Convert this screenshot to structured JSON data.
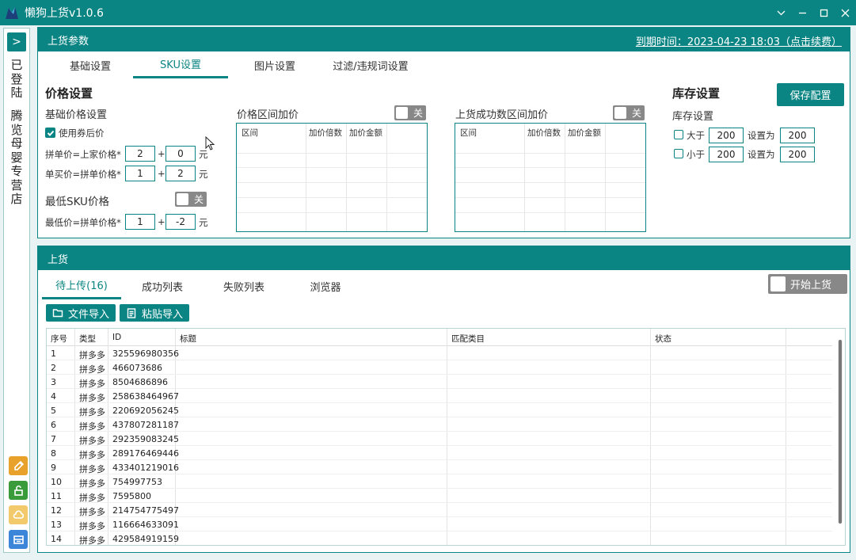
{
  "window": {
    "title": "懒狗上货v1.0.6",
    "accent": "#0b8583"
  },
  "sidebar": {
    "expand_label": ">",
    "login_status": "已登陆",
    "shop_name": "腾览母婴专营店",
    "buttons": [
      "edit-icon",
      "unlock-icon",
      "cloud-icon",
      "tray-icon"
    ]
  },
  "params": {
    "header": "上货参数",
    "expiry": "到期时间：2023-04-23 18:03（点击续费）",
    "tabs": [
      "基础设置",
      "SKU设置",
      "图片设置",
      "过滤/违规词设置"
    ],
    "active_tab": "SKU设置",
    "price": {
      "title": "价格设置",
      "basic_title": "基础价格设置",
      "use_coupon_label": "使用券后价",
      "group_price_label": "拼单价=上家价格*",
      "group_multiplier": "2",
      "group_add": "0",
      "single_price_label": "单买价=拼单价格*",
      "single_multiplier": "1",
      "single_add": "2",
      "plus": "+",
      "unit": "元",
      "min_sku_title": "最低SKU价格",
      "min_sku_toggle": "关",
      "min_price_label": "最低价=拼单价格*",
      "min_multiplier": "1",
      "min_add": "-2"
    },
    "range_markup": {
      "title": "价格区间加价",
      "toggle": "关",
      "columns": [
        "区间",
        "加价倍数",
        "加价金额"
      ]
    },
    "success_markup": {
      "title": "上货成功数区间加价",
      "toggle": "关",
      "columns": [
        "区间",
        "加价倍数",
        "加价金额"
      ]
    },
    "stock": {
      "title": "库存设置",
      "subtitle": "库存设置",
      "save_label": "保存配置",
      "gt_label": "大于",
      "gt_value": "200",
      "gt_set_label": "设置为",
      "gt_set_value": "200",
      "lt_label": "小于",
      "lt_value": "200",
      "lt_set_label": "设置为",
      "lt_set_value": "200"
    }
  },
  "upload": {
    "header": "上货",
    "tabs": [
      "待上传(16)",
      "成功列表",
      "失败列表",
      "浏览器"
    ],
    "active_tab": "待上传(16)",
    "start_label": "开始上货",
    "file_import_label": "文件导入",
    "paste_import_label": "粘贴导入",
    "columns": [
      "序号",
      "类型",
      "ID",
      "标题",
      "匹配类目",
      "状态"
    ],
    "rows": [
      {
        "no": "1",
        "type": "拼多多",
        "id": "325596980356"
      },
      {
        "no": "2",
        "type": "拼多多",
        "id": "466073686"
      },
      {
        "no": "3",
        "type": "拼多多",
        "id": "8504686896"
      },
      {
        "no": "4",
        "type": "拼多多",
        "id": "258638464967"
      },
      {
        "no": "5",
        "type": "拼多多",
        "id": "220692056245"
      },
      {
        "no": "6",
        "type": "拼多多",
        "id": "437807281187"
      },
      {
        "no": "7",
        "type": "拼多多",
        "id": "292359083245"
      },
      {
        "no": "8",
        "type": "拼多多",
        "id": "289176469446"
      },
      {
        "no": "9",
        "type": "拼多多",
        "id": "433401219016"
      },
      {
        "no": "10",
        "type": "拼多多",
        "id": "754997753"
      },
      {
        "no": "11",
        "type": "拼多多",
        "id": "7595800"
      },
      {
        "no": "12",
        "type": "拼多多",
        "id": "214754775497"
      },
      {
        "no": "13",
        "type": "拼多多",
        "id": "116664633091"
      },
      {
        "no": "14",
        "type": "拼多多",
        "id": "429584919159"
      }
    ]
  }
}
